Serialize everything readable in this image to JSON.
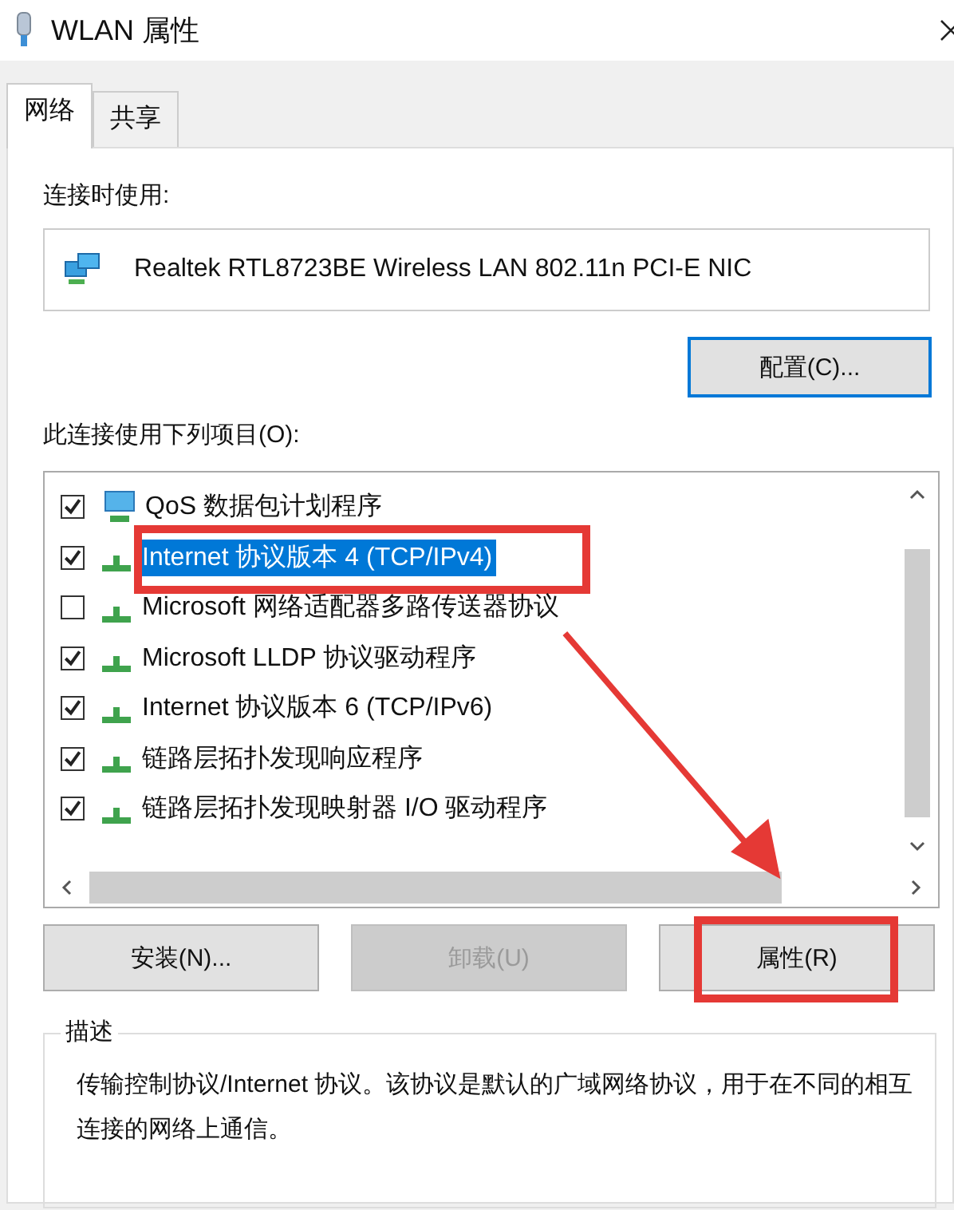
{
  "window": {
    "title": "WLAN 属性"
  },
  "tabs": [
    {
      "label": "网络",
      "selected": true
    },
    {
      "label": "共享",
      "selected": false
    }
  ],
  "connect_using": {
    "label": "连接时使用:",
    "adapter": "Realtek RTL8723BE Wireless LAN 802.11n PCI-E NIC",
    "configure_button": "配置(C)..."
  },
  "items": {
    "label": "此连接使用下列项目(O):",
    "rows": [
      {
        "kind": "scheduler",
        "label": "QoS 数据包计划程序",
        "checked": true,
        "selected": false,
        "annotated": false
      },
      {
        "kind": "protocol",
        "label": "Internet 协议版本 4 (TCP/IPv4)",
        "checked": true,
        "selected": true,
        "annotated": true
      },
      {
        "kind": "protocol",
        "label": "Microsoft 网络适配器多路传送器协议",
        "checked": false,
        "selected": false,
        "annotated": false
      },
      {
        "kind": "protocol",
        "label": "Microsoft LLDP 协议驱动程序",
        "checked": true,
        "selected": false,
        "annotated": false
      },
      {
        "kind": "protocol",
        "label": "Internet 协议版本 6 (TCP/IPv6)",
        "checked": true,
        "selected": false,
        "annotated": false
      },
      {
        "kind": "protocol",
        "label": "链路层拓扑发现响应程序",
        "checked": true,
        "selected": false,
        "annotated": false
      },
      {
        "kind": "protocol",
        "label": "链路层拓扑发现映射器 I/O 驱动程序",
        "checked": true,
        "selected": false,
        "annotated": false
      }
    ]
  },
  "buttons": [
    {
      "label": "安装(N)...",
      "disabled": false,
      "annotated": false
    },
    {
      "label": "卸载(U)",
      "disabled": true,
      "annotated": false
    },
    {
      "label": "属性(R)",
      "disabled": false,
      "annotated": true
    }
  ],
  "description": {
    "title": "描述",
    "text": "传输控制协议/Internet 协议。该协议是默认的广域网络协议，用于在不同的相互连接的网络上通信。"
  }
}
